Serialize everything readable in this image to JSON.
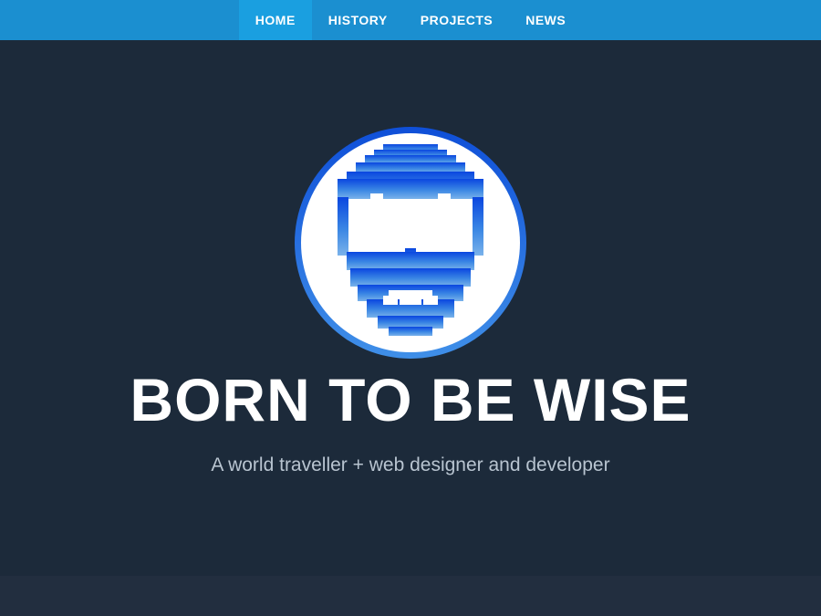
{
  "nav": {
    "items": [
      {
        "label": "HOME",
        "active": true
      },
      {
        "label": "HISTORY",
        "active": false
      },
      {
        "label": "PROJECTS",
        "active": false
      },
      {
        "label": "NEWS",
        "active": false
      }
    ]
  },
  "hero": {
    "logo_icon": "pixel-bearded-face-with-sunglasses-icon",
    "title": "BORN TO BE WISE",
    "subtitle": "A world traveller + web designer and developer"
  },
  "colors": {
    "nav_bg": "#1b8fd0",
    "nav_active_bg": "#1a9fe0",
    "hero_bg": "#1c2a3a",
    "footer_bg": "#222e3f",
    "logo_blue_top": "#0f52e0",
    "logo_blue_bottom": "#7ab4ec"
  }
}
